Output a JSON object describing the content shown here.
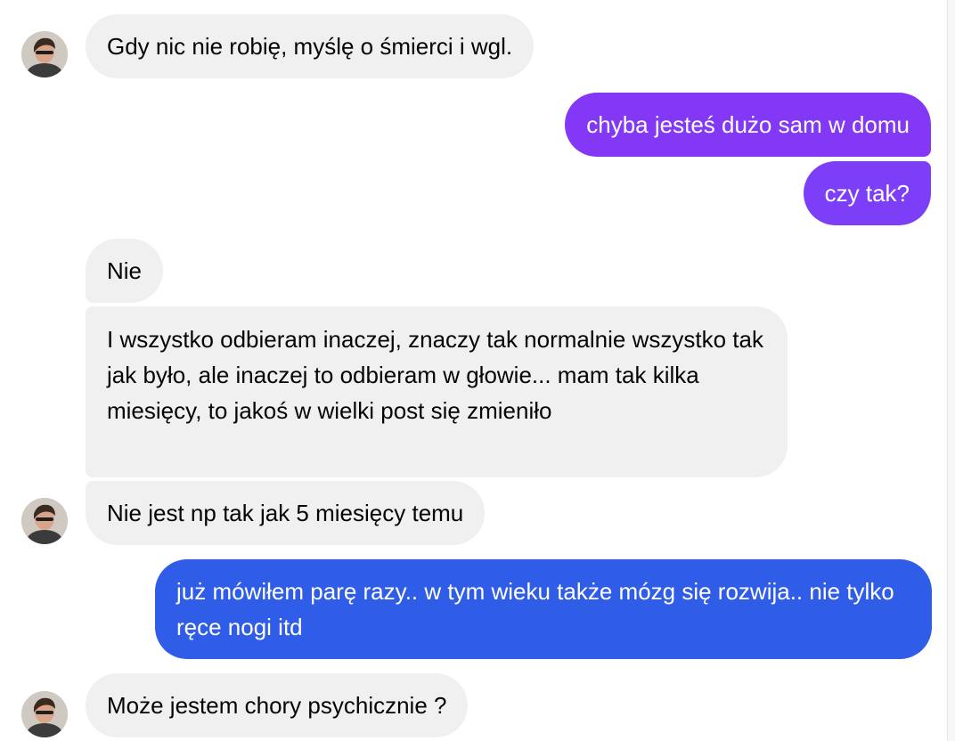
{
  "chat": {
    "incoming_color": "#f0f0f0",
    "outgoing_colors": [
      "#8338f5",
      "#7c3ef6",
      "#2f5de8"
    ],
    "avatar_icon": "user-avatar-icon",
    "messages": [
      {
        "sender": "them",
        "text": "Gdy nic nie robię, myślę o śmierci i wgl."
      },
      {
        "sender": "me",
        "text": "chyba jesteś dużo sam w domu"
      },
      {
        "sender": "me",
        "text": "czy tak?"
      },
      {
        "sender": "them",
        "text": "Nie"
      },
      {
        "sender": "them",
        "text": "I wszystko odbieram inaczej, znaczy tak normalnie wszystko tak jak było, ale inaczej to odbieram w głowie... mam tak kilka miesięcy, to jakoś w wielki post się zmieniło"
      },
      {
        "sender": "them",
        "text": "Nie jest np tak jak 5 miesięcy temu"
      },
      {
        "sender": "me",
        "text": "już mówiłem parę razy.. w tym wieku także mózg się rozwija.. nie tylko ręce nogi itd"
      },
      {
        "sender": "them",
        "text": "Może jestem chory psychicznie ?"
      }
    ]
  }
}
